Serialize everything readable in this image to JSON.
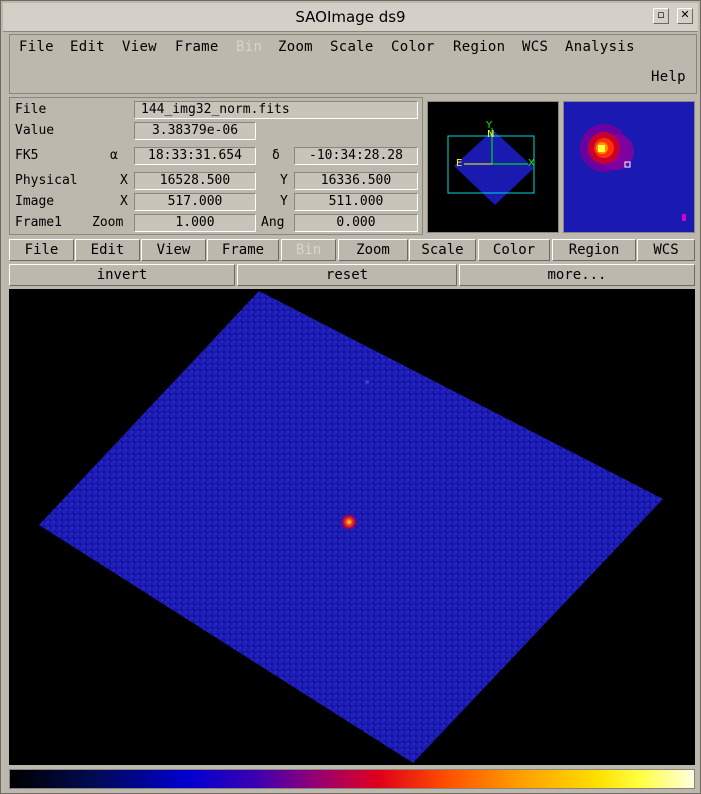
{
  "window": {
    "title": "SAOImage ds9"
  },
  "titlebar_icons": [
    "restore-icon",
    "close-icon"
  ],
  "menubar": {
    "items": [
      {
        "label": "File",
        "enabled": true
      },
      {
        "label": "Edit",
        "enabled": true
      },
      {
        "label": "View",
        "enabled": true
      },
      {
        "label": "Frame",
        "enabled": true
      },
      {
        "label": "Bin",
        "enabled": false
      },
      {
        "label": "Zoom",
        "enabled": true
      },
      {
        "label": "Scale",
        "enabled": true
      },
      {
        "label": "Color",
        "enabled": true
      },
      {
        "label": "Region",
        "enabled": true
      },
      {
        "label": "WCS",
        "enabled": true
      },
      {
        "label": "Analysis",
        "enabled": true
      }
    ],
    "help": "Help"
  },
  "info": {
    "file_label": "File",
    "file_value": "144_img32_norm.fits",
    "value_label": "Value",
    "value_value": "3.38379e-06",
    "fk5_label": "FK5",
    "alpha_symbol": "α",
    "alpha_value": "18:33:31.654",
    "delta_symbol": "δ",
    "delta_value": "-10:34:28.28",
    "physical_label": "Physical",
    "physical_x_label": "X",
    "physical_x": "16528.500",
    "physical_y_label": "Y",
    "physical_y": "16336.500",
    "image_label": "Image",
    "image_x_label": "X",
    "image_x": "517.000",
    "image_y_label": "Y",
    "image_y": "511.000",
    "frame_label": "Frame1",
    "zoom_label": "Zoom",
    "zoom_value": "1.000",
    "ang_label": "Ang",
    "ang_value": "0.000"
  },
  "panner": {
    "n": "N",
    "e": "E",
    "x": "X",
    "y": "Y"
  },
  "buttonbar": {
    "items": [
      {
        "label": "File",
        "enabled": true
      },
      {
        "label": "Edit",
        "enabled": true
      },
      {
        "label": "View",
        "enabled": true
      },
      {
        "label": "Frame",
        "enabled": true
      },
      {
        "label": "Bin",
        "enabled": false
      },
      {
        "label": "Zoom",
        "enabled": true
      },
      {
        "label": "Scale",
        "enabled": true
      },
      {
        "label": "Color",
        "enabled": true
      },
      {
        "label": "Region",
        "enabled": true
      },
      {
        "label": "WCS",
        "enabled": true
      }
    ]
  },
  "subbuttons": {
    "items": [
      {
        "label": "invert"
      },
      {
        "label": "reset"
      },
      {
        "label": "more..."
      }
    ]
  },
  "colors": {
    "image_field": "#1a1ab0",
    "background": "#000000",
    "panel": "#bdb8ad",
    "compass": "#ffff00",
    "axes": "#00ff00",
    "panner_box": "#00d8d8"
  }
}
